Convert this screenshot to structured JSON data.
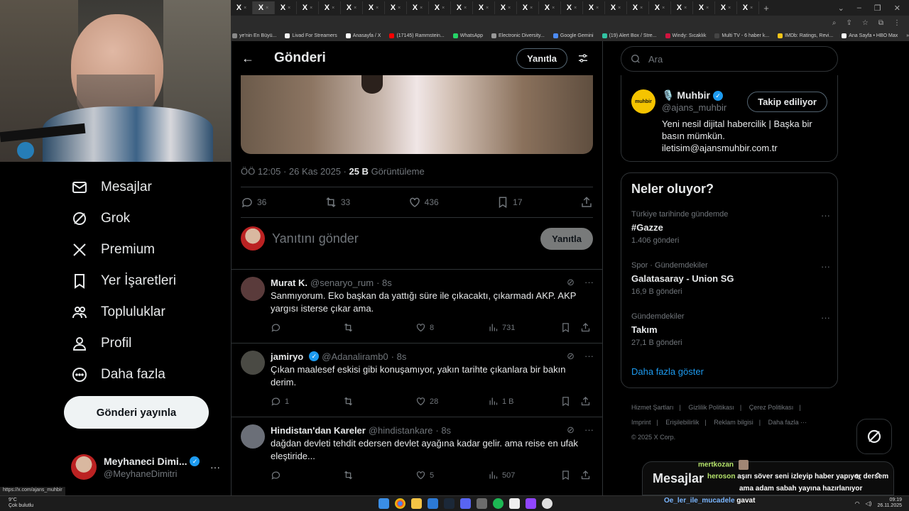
{
  "browser": {
    "tab_count": 24,
    "tab_label": "X",
    "tab_close": "×",
    "new_tab": "+",
    "window_controls": [
      "⌄",
      "–",
      "❐",
      "✕"
    ],
    "address_icons": [
      "⌕",
      "⇪",
      "☆",
      "⧉",
      "⋮"
    ],
    "bookmarks": [
      {
        "label": "ye'nin En Büyü...",
        "color": "#888888"
      },
      {
        "label": "Livad For Streamers",
        "color": "#f2f2f2"
      },
      {
        "label": "Anasayfa / X",
        "color": "#ffffff"
      },
      {
        "label": "(17145) Rammstein...",
        "color": "#ff0000"
      },
      {
        "label": "WhatsApp",
        "color": "#25d366"
      },
      {
        "label": "Electronic Diversity...",
        "color": "#999999"
      },
      {
        "label": "Google Gemini",
        "color": "#4c8bf5"
      },
      {
        "label": "(19) Alert Box / Stre...",
        "color": "#31c3a2"
      },
      {
        "label": "Windy: Sıcaklık",
        "color": "#d0143f"
      },
      {
        "label": "Multi TV - 6 haber k...",
        "color": "#444444"
      },
      {
        "label": "IMDb: Ratings, Revi...",
        "color": "#f5c518"
      },
      {
        "label": "Ana Sayfa • HBO Max",
        "color": "#ffffff"
      }
    ],
    "bookmarks_more": "»",
    "bookmarks_folder": "Tüm Yer İşaretleri",
    "status_link": "https://x.com/ajans_muhbir"
  },
  "nav": {
    "items": [
      {
        "label": "Mesajlar",
        "icon": "envelope-icon"
      },
      {
        "label": "Grok",
        "icon": "grok-icon"
      },
      {
        "label": "Premium",
        "icon": "x-logo-icon"
      },
      {
        "label": "Yer İşaretleri",
        "icon": "bookmark-icon"
      },
      {
        "label": "Topluluklar",
        "icon": "people-icon"
      },
      {
        "label": "Profil",
        "icon": "person-icon"
      },
      {
        "label": "Daha fazla",
        "icon": "more-circle-icon"
      }
    ],
    "post_button": "Gönderi yayınla",
    "account": {
      "name": "Meyhaneci Dimi...",
      "handle": "@MeyhaneDimitri",
      "more": "···"
    }
  },
  "post": {
    "header_title": "Gönderi",
    "reply_button": "Yanıtla",
    "time": "ÖÖ 12:05 · 26 Kas 2025 · ",
    "views_count": "25 B",
    "views_label": " Görüntüleme",
    "replies": "36",
    "reposts": "33",
    "likes": "436",
    "bookmarks": "17",
    "compose_placeholder": "Yanıtını gönder",
    "compose_button": "Yanıtla"
  },
  "replies": [
    {
      "name": "Murat K.",
      "verified": false,
      "handle": "@senaryo_rum",
      "time": "· 8s",
      "text": "Sanmıyorum. Eko başkan da yattığı süre ile çıkacaktı, çıkarmadı AKP. AKP yargısı isterse çıkar ama.",
      "replies": "",
      "reposts": "",
      "likes": "8",
      "views": "731",
      "avatar_color": "#5a3b3b"
    },
    {
      "name": "jamiryo",
      "verified": true,
      "handle": "@Adanaliramb0",
      "time": "· 8s",
      "text": "Çıkan maalesef eskisi gibi konuşamıyor, yakın tarihte çıkanlara bir bakın derim.",
      "replies": "1",
      "reposts": "",
      "likes": "28",
      "views": "1 B",
      "avatar_color": "#4a4a44"
    },
    {
      "name": "Hindistan'dan Kareler",
      "verified": false,
      "handle": "@hindistankare",
      "time": "· 8s",
      "text": "dağdan devleti tehdit edersen devlet ayağına kadar gelir. ama reise en ufak eleştiride...",
      "replies": "",
      "reposts": "",
      "likes": "5",
      "views": "507",
      "avatar_color": "#6b6f78"
    }
  ],
  "right": {
    "search_placeholder": "Ara",
    "profile": {
      "emoji": "🎙️",
      "name": "Muhbir",
      "handle": "@ajans_muhbir",
      "follow_label": "Takip ediliyor",
      "bio": "Yeni nesil dijital habercilik | Başka bir basın mümkün. iletisim@ajansmuhbir.com.tr",
      "logo_text": "muhbir",
      "logo_color": "#f5c400"
    },
    "trends_title": "Neler oluyor?",
    "trends": [
      {
        "context": "Türkiye tarihinde gündemde",
        "name": "#Gazze",
        "count": "1.406 gönderi"
      },
      {
        "context": "Spor · Gündemdekiler",
        "name": "Galatasaray - Union SG",
        "count": "16,9 B gönderi"
      },
      {
        "context": "Gündemdekiler",
        "name": "Takım",
        "count": "27,1 B gönderi"
      }
    ],
    "show_more": "Daha fazla göster",
    "footer": [
      "Hizmet Şartları",
      "|",
      "Gizlilik Politikası",
      "|",
      "Çerez Politikası",
      "|",
      "Imprint",
      "|",
      "Erişilebilirlik",
      "|",
      "Reklam bilgisi",
      "|",
      "Daha fazla ···",
      "© 2025 X Corp."
    ]
  },
  "messages": {
    "title": "Mesajlar"
  },
  "chat": [
    {
      "user": "mertkozan",
      "text": ""
    },
    {
      "user": "heroson",
      "text": "aşırı söver seni izleyip haber yapıyor dersem"
    },
    {
      "user": "",
      "text": "ama adam sabah yayına hazırlanıyor"
    },
    {
      "user": "Oe_ler_ile_mucadele",
      "text": "gavat"
    }
  ],
  "taskbar": {
    "weather_temp": "9°C",
    "weather_text": "Çok bulutlu",
    "time": "09:19",
    "date": "26.11.2025"
  }
}
